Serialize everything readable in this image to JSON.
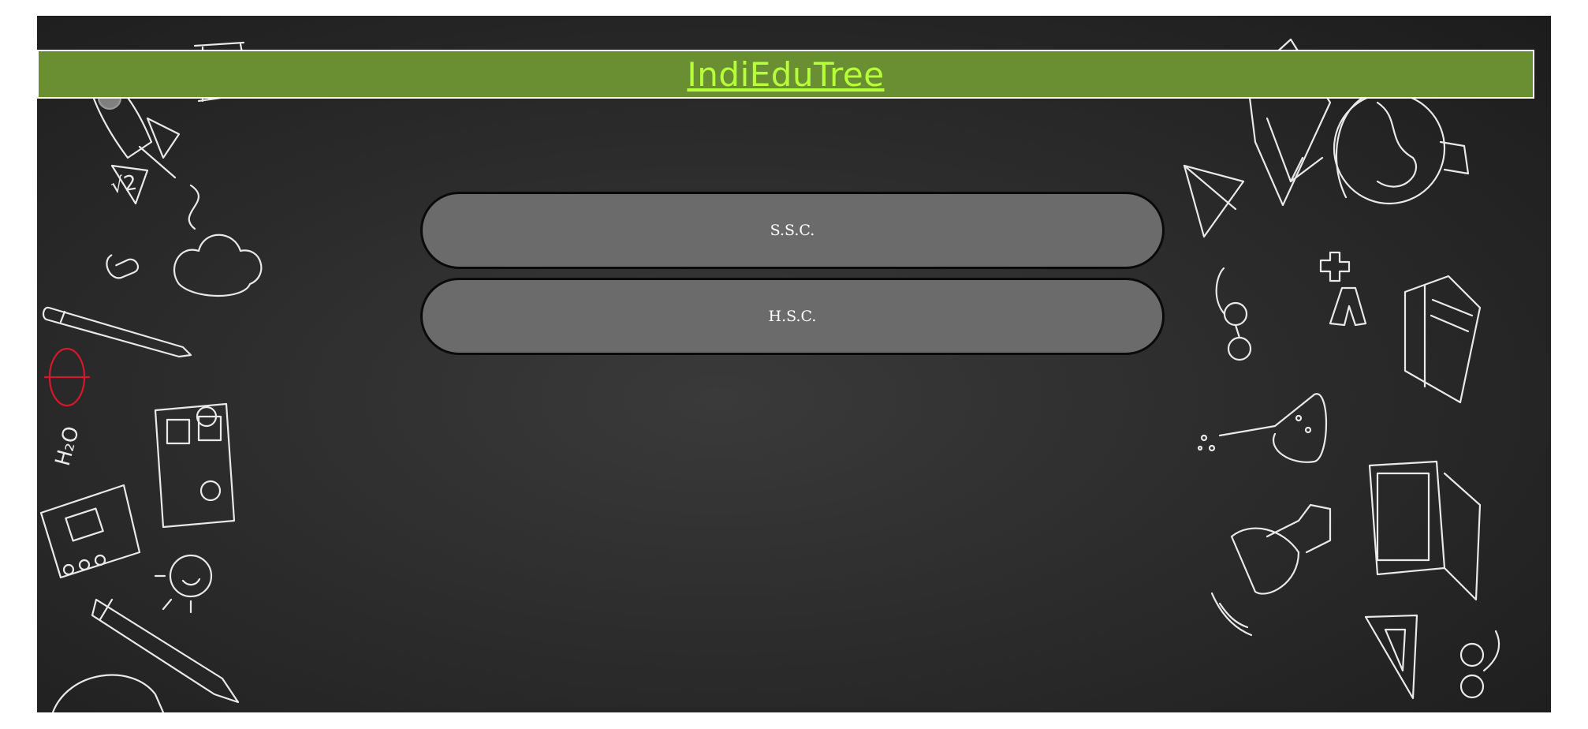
{
  "site": {
    "title": "IndiEduTree"
  },
  "menu": {
    "items": [
      {
        "label": "S.S.C."
      },
      {
        "label": "H.S.C."
      }
    ]
  },
  "colors": {
    "header_background": "#6a8f33",
    "title_text": "#b6ff3a",
    "button_background": "#6b6b6b",
    "chalkboard": "#2c2c2c"
  },
  "decorations": {
    "left": [
      "rocket-icon",
      "abacus-icon",
      "sqrt2-icon",
      "paperclip-icon",
      "pencil-icon",
      "red-bulb-icon",
      "h2o-icon",
      "bus-icon",
      "notebook-icon",
      "sun-icon",
      "pen-icon",
      "watch-icon"
    ],
    "right": [
      "paper-plane-icon",
      "graduation-cap-icon",
      "globe-icon",
      "glasses-icon",
      "plus-icon",
      "letter-a-icon",
      "open-book-icon",
      "flask-icon",
      "laptop-icon",
      "satellite-icon",
      "set-square-icon",
      "glasses-bottom-icon"
    ]
  }
}
